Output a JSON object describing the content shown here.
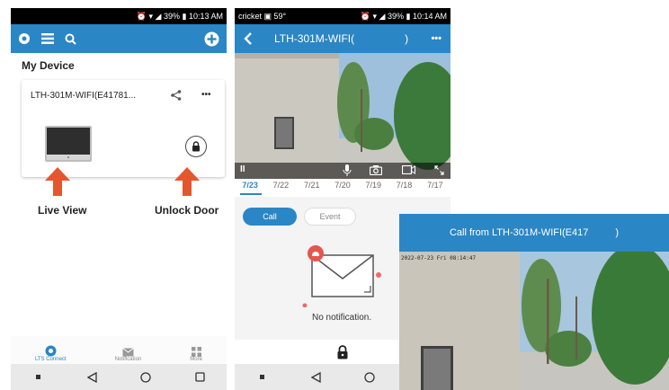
{
  "phone1": {
    "status_time": "10:13 AM",
    "status_battery": "39%",
    "section_title": "My Device",
    "device_name": "LTH-301M-WIFI(E41781...",
    "more_label": "•••",
    "caption_left": "Live View",
    "caption_right": "Unlock Door",
    "tabs": [
      {
        "label": "LTS Connect"
      },
      {
        "label": "Notification"
      },
      {
        "label": "More"
      }
    ],
    "accent": "#2b86c5",
    "arrow_color": "#e4572e"
  },
  "phone2": {
    "carrier": "cricket",
    "temp": "59°",
    "status_battery": "39%",
    "status_time": "10:14 AM",
    "title_left": "LTH-301M-WIFI(",
    "title_right": ")",
    "more_label": "•••",
    "dates": [
      "7/23",
      "7/22",
      "7/21",
      "7/20",
      "7/19",
      "7/18",
      "7/17"
    ],
    "segment_call": "Call",
    "segment_event": "Event",
    "empty_text": "No notification.",
    "pause_label": "II"
  },
  "call_overlay": {
    "title_left": "Call from LTH-301M-WIFI(E417",
    "title_right": ")",
    "osd_text": "2022-07-23 Fri 08:14:47"
  }
}
